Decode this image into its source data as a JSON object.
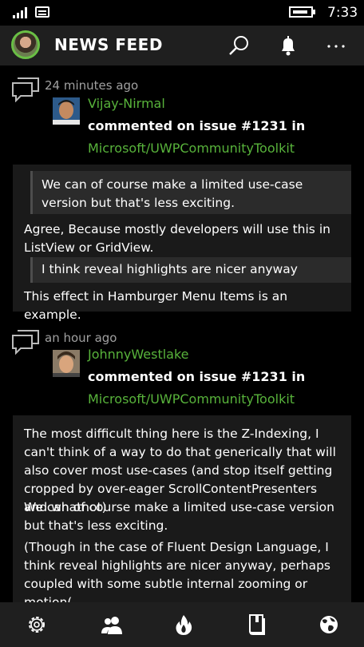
{
  "status": {
    "time": "7:33"
  },
  "header": {
    "title": "NEWS FEED"
  },
  "feed": [
    {
      "time": "24 minutes ago",
      "user": "Vijay-Nirmal",
      "action": "commented on issue #1231 in",
      "repo": "Microsoft/UWPCommunityToolkit",
      "quote1": "We can of course make a limited use-case version but that's less exciting.",
      "para1": "Agree, Because mostly developers will use this in ListView or GridView.",
      "quote2": "I think reveal highlights are nicer anyway",
      "para2": "This effect in Hamburger Menu Items is an example."
    },
    {
      "time": "an hour ago",
      "user": "JohnnyWestlake",
      "action": "commented on issue #1231 in",
      "repo": "Microsoft/UWPCommunityToolkit",
      "para1": "The most difficult thing here is the Z-Indexing, I can't think of a way to do that generically that will also cover most use-cases (and stop itself getting cropped by over-eager ScrollContentPresenters and whatnot)",
      "para2": "We can of course make a limited use-case version but that's less exciting.",
      "para3": "(Though in the case of Fluent Design Language, I think reveal highlights are nicer anyway, perhaps coupled with some subtle internal zooming or motion("
    }
  ],
  "colors": {
    "accent": "#58b33b",
    "background": "#000000",
    "bar": "#1f1f1f",
    "card": "#1a1a1a",
    "quote": "#2b2b2b"
  },
  "icons": [
    "signal-icon",
    "message-icon",
    "battery-icon",
    "search-icon",
    "bell-icon",
    "more-icon",
    "comment-icon",
    "settings-icon",
    "people-icon",
    "fire-icon",
    "book-icon",
    "globe-icon"
  ]
}
